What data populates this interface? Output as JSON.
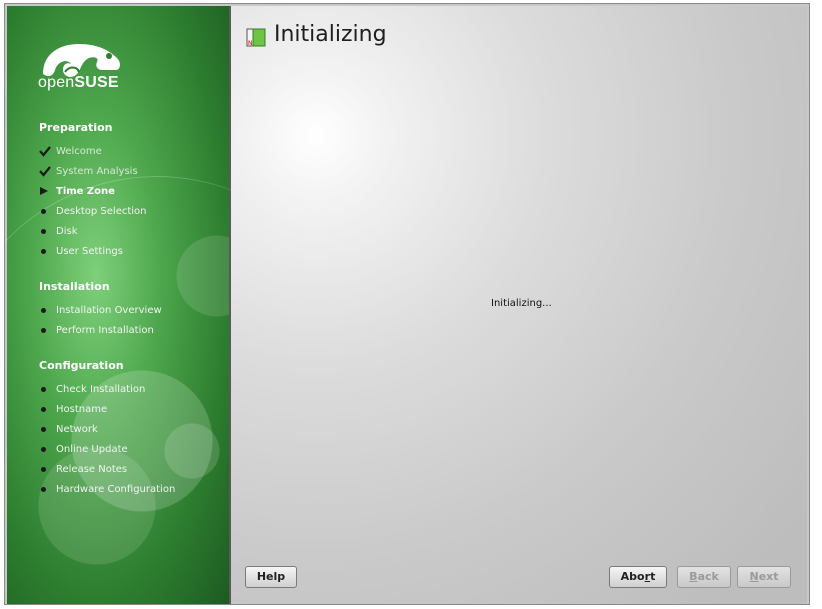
{
  "logo": {
    "brand_prefix": "open",
    "brand_name": "SUSE"
  },
  "sidebar": {
    "sections": [
      {
        "title": "Preparation",
        "steps": [
          {
            "label": "Welcome",
            "status": "done"
          },
          {
            "label": "System Analysis",
            "status": "done"
          },
          {
            "label": "Time Zone",
            "status": "current"
          },
          {
            "label": "Desktop Selection",
            "status": "pending"
          },
          {
            "label": "Disk",
            "status": "pending"
          },
          {
            "label": "User Settings",
            "status": "pending"
          }
        ]
      },
      {
        "title": "Installation",
        "steps": [
          {
            "label": "Installation Overview",
            "status": "pending"
          },
          {
            "label": "Perform Installation",
            "status": "pending"
          }
        ]
      },
      {
        "title": "Configuration",
        "steps": [
          {
            "label": "Check Installation",
            "status": "pending"
          },
          {
            "label": "Hostname",
            "status": "pending"
          },
          {
            "label": "Network",
            "status": "pending"
          },
          {
            "label": "Online Update",
            "status": "pending"
          },
          {
            "label": "Release Notes",
            "status": "pending"
          },
          {
            "label": "Hardware Configuration",
            "status": "pending"
          }
        ]
      }
    ]
  },
  "main": {
    "title": "Initializing",
    "status_text": "Initializing...",
    "title_icon": "installer-icon"
  },
  "buttons": {
    "help": "Help",
    "abort": {
      "before": "Abo",
      "mnemonic": "r",
      "after": "t"
    },
    "back": {
      "before": "",
      "mnemonic": "B",
      "after": "ack"
    },
    "next": {
      "before": "",
      "mnemonic": "N",
      "after": "ext"
    }
  },
  "colors": {
    "sidebar_green": "#4da64c",
    "sidebar_dark": "#1d5a22",
    "main_bg": "#d0d0d0"
  }
}
